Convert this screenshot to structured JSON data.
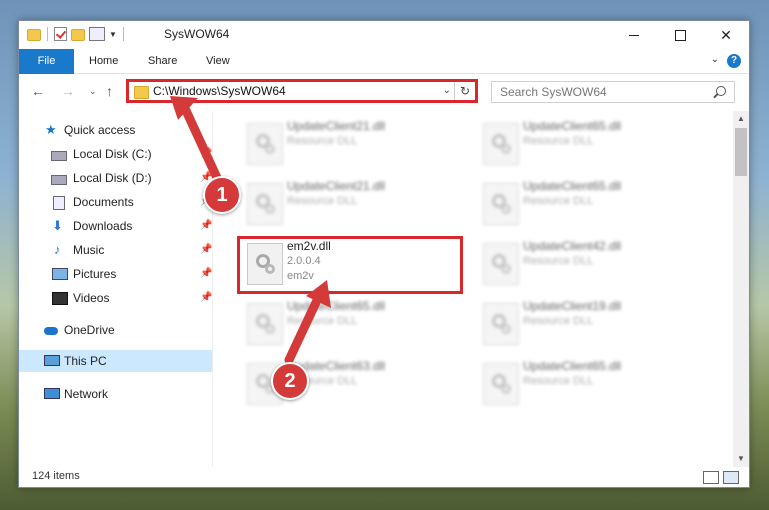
{
  "window": {
    "title": "SysWOW64"
  },
  "ribbon": {
    "tabs": [
      "File",
      "Home",
      "Share",
      "View"
    ],
    "help": "?"
  },
  "address": {
    "path": "C:\\Windows\\SysWOW64"
  },
  "search": {
    "placeholder": "Search SysWOW64"
  },
  "sidebar": {
    "items": [
      {
        "label": "Quick access"
      },
      {
        "label": "Local Disk (C:)"
      },
      {
        "label": "Local Disk (D:)"
      },
      {
        "label": "Documents"
      },
      {
        "label": "Downloads"
      },
      {
        "label": "Music"
      },
      {
        "label": "Pictures"
      },
      {
        "label": "Videos"
      },
      {
        "label": "OneDrive"
      },
      {
        "label": "This PC"
      },
      {
        "label": "Network"
      }
    ]
  },
  "files": [
    {
      "name": "UpdateClient21.dll",
      "type": "Resource DLL"
    },
    {
      "name": "UpdateClient65.dll",
      "type": "Resource DLL"
    },
    {
      "name": "UpdateClient21.dll",
      "type": "Resource DLL"
    },
    {
      "name": "UpdateClient65.dll",
      "type": "Resource DLL"
    },
    {
      "name": "em2v.dll",
      "version": "2.0.0.4",
      "desc": "em2v"
    },
    {
      "name": "UpdateClient42.dll",
      "type": "Resource DLL"
    },
    {
      "name": "UpdateClient65.dll",
      "type": "Resource DLL"
    },
    {
      "name": "UpdateClient19.dll",
      "type": "Resource DLL"
    },
    {
      "name": "UpdateClient63.dll",
      "type": "Resource DLL"
    },
    {
      "name": "UpdateClient65.dll",
      "type": "Resource DLL"
    }
  ],
  "status": {
    "count": "124 items"
  },
  "markers": {
    "one": "1",
    "two": "2"
  },
  "colors": {
    "accent": "#1979ca",
    "highlight": "#d9272e",
    "marker": "#d43a3a"
  }
}
